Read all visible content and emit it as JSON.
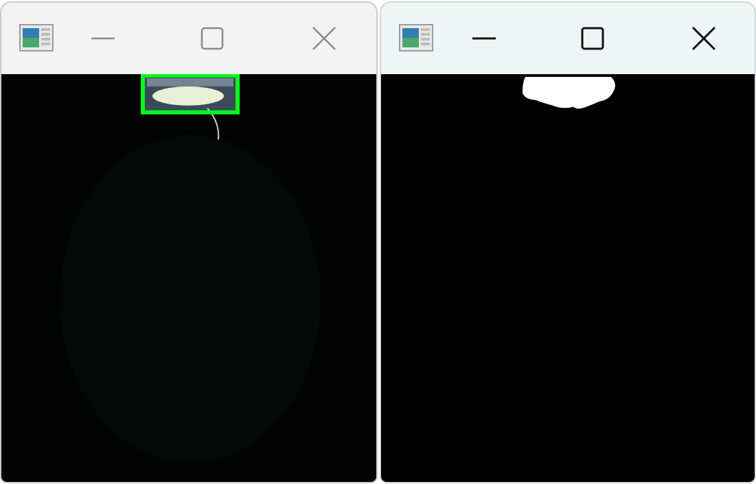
{
  "colors": {
    "titlebar_left": "#f3f3f3",
    "titlebar_right": "#eef5f4",
    "inactive_glyph": "#8a8a8a",
    "active_glyph": "#111111",
    "bbox_green": "#00ff1a",
    "mask_white": "#ffffff",
    "frame_black": "#020403"
  },
  "windows": [
    {
      "name": "camera-feed-window",
      "state": "inactive",
      "controls": {
        "minimize": "minimize-icon",
        "maximize": "maximize-icon",
        "close": "close-icon"
      },
      "content": "video-frame-with-detection-box"
    },
    {
      "name": "mask-window",
      "state": "active",
      "controls": {
        "minimize": "minimize-icon",
        "maximize": "maximize-icon",
        "close": "close-icon"
      },
      "content": "binary-mask"
    }
  ]
}
